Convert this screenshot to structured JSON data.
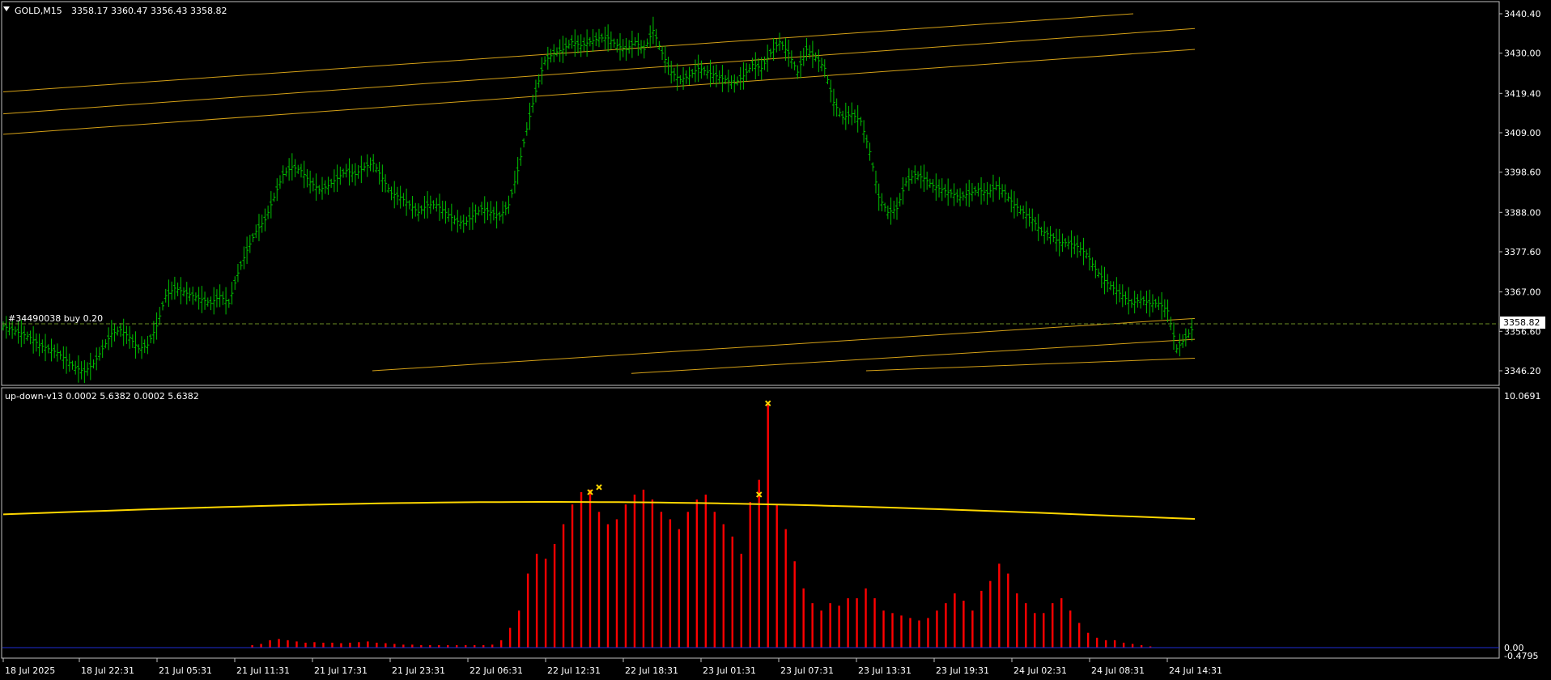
{
  "colors": {
    "background": "#000000",
    "frame": "#c0c0c0",
    "candle": "#00c000",
    "channel": "#d4a017",
    "bid_line": "#6b8e23",
    "histogram": "#ff0000",
    "signal_line": "#ffd700",
    "marker": "#ffd700",
    "zero_line": "#1e2bd6",
    "text": "#ffffff"
  },
  "main_panel": {
    "title_icon": "triangle-down-icon",
    "symbol": "GOLD,M15",
    "ohlc": "3358.17 3360.47 3356.43 3358.82",
    "position_label": "#34490038 buy 0.20",
    "current_price": "3358.82",
    "price_labels": [
      "3440.40",
      "3430.00",
      "3419.40",
      "3409.00",
      "3398.60",
      "3388.00",
      "3377.60",
      "3367.00",
      "3356.60",
      "3346.20"
    ]
  },
  "indicator_panel": {
    "title": "up-down-v13 0.0002 5.6382 0.0002 5.6382",
    "labels": [
      "10.0691",
      "0.00",
      "-0.4795"
    ]
  },
  "time_labels": [
    "18 Jul 2025",
    "18 Jul 22:31",
    "21 Jul 05:31",
    "21 Jul 11:31",
    "21 Jul 17:31",
    "21 Jul 23:31",
    "22 Jul 06:31",
    "22 Jul 12:31",
    "22 Jul 18:31",
    "23 Jul 01:31",
    "23 Jul 07:31",
    "23 Jul 13:31",
    "23 Jul 19:31",
    "24 Jul 02:31",
    "24 Jul 08:31",
    "24 Jul 14:31"
  ],
  "chart_data": {
    "type": "line",
    "title": "GOLD,M15",
    "price_axis": {
      "min": 3346.2,
      "max": 3440.4
    },
    "close_series": [
      3358,
      3357,
      3356,
      3355,
      3353,
      3352,
      3351,
      3349,
      3347,
      3346,
      3348,
      3352,
      3356,
      3357,
      3355,
      3352,
      3353,
      3358,
      3366,
      3368,
      3367,
      3366,
      3365,
      3364,
      3366,
      3364,
      3372,
      3378,
      3383,
      3386,
      3392,
      3398,
      3400,
      3399,
      3396,
      3394,
      3395,
      3397,
      3399,
      3398,
      3400,
      3401,
      3397,
      3393,
      3392,
      3390,
      3388,
      3390,
      3390,
      3388,
      3386,
      3385,
      3387,
      3389,
      3388,
      3387,
      3390,
      3399,
      3410,
      3420,
      3428,
      3430,
      3431,
      3433,
      3432,
      3433,
      3434,
      3434,
      3432,
      3431,
      3433,
      3431,
      3436,
      3430,
      3425,
      3423,
      3424,
      3426,
      3425,
      3424,
      3423,
      3422,
      3424,
      3427,
      3426,
      3430,
      3433,
      3430,
      3425,
      3431,
      3429,
      3426,
      3417,
      3413,
      3414,
      3412,
      3404,
      3392,
      3388,
      3389,
      3396,
      3398,
      3397,
      3395,
      3394,
      3393,
      3392,
      3393,
      3394,
      3393,
      3395,
      3393,
      3390,
      3388,
      3386,
      3383,
      3382,
      3380,
      3380,
      3379,
      3377,
      3373,
      3370,
      3368,
      3366,
      3364,
      3365,
      3364,
      3364,
      3362,
      3352,
      3355,
      3358
    ]
  },
  "indicator_data": {
    "type": "bar",
    "axis": {
      "min": -0.4795,
      "max": 10.0691
    },
    "histogram": [
      0,
      0,
      0,
      0,
      0,
      0,
      0,
      0,
      0,
      0,
      0,
      0,
      0,
      0,
      0,
      0,
      0,
      0,
      0,
      0,
      0,
      0,
      0,
      0,
      0,
      0,
      0,
      0,
      0.1,
      0.15,
      0.3,
      0.35,
      0.3,
      0.25,
      0.2,
      0.22,
      0.2,
      0.2,
      0.18,
      0.2,
      0.22,
      0.25,
      0.2,
      0.18,
      0.15,
      0.12,
      0.12,
      0.1,
      0.1,
      0.1,
      0.1,
      0.1,
      0.1,
      0.1,
      0.1,
      0.12,
      0.3,
      0.8,
      1.5,
      3.0,
      3.8,
      3.6,
      4.2,
      5.0,
      5.8,
      6.3,
      6.4,
      5.5,
      5.0,
      5.2,
      5.8,
      6.2,
      6.4,
      6.0,
      5.5,
      5.2,
      4.8,
      5.5,
      6.0,
      6.2,
      5.5,
      5.0,
      4.5,
      3.8,
      5.9,
      6.8,
      9.9,
      5.8,
      4.8,
      3.5,
      2.4,
      1.8,
      1.5,
      1.8,
      1.7,
      2.0,
      2.0,
      2.4,
      2.0,
      1.5,
      1.4,
      1.3,
      1.2,
      1.1,
      1.2,
      1.5,
      1.8,
      2.2,
      1.9,
      1.5,
      2.3,
      2.7,
      3.4,
      3.0,
      2.2,
      1.8,
      1.4,
      1.4,
      1.8,
      2.0,
      1.5,
      1.0,
      0.6,
      0.4,
      0.3,
      0.3,
      0.2,
      0.15,
      0.1,
      0.05,
      0,
      0,
      0,
      0,
      0
    ],
    "signal_level": 5.8,
    "markers": [
      6.3,
      6.5,
      6.2,
      9.9
    ]
  }
}
